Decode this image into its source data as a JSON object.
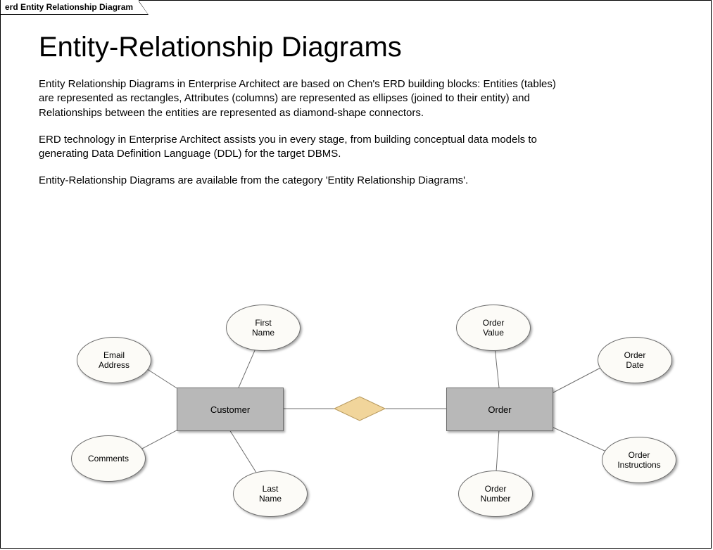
{
  "tab_label": "erd Entity Relationship Diagram",
  "title": "Entity-Relationship Diagrams",
  "para1": "Entity Relationship Diagrams in Enterprise Architect are based on Chen's ERD building blocks: Entities (tables) are represented as rectangles, Attributes (columns) are represented as ellipses (joined to their entity) and Relationships between the entities are represented as diamond-shape connectors.",
  "para2": "ERD technology in Enterprise Architect assists you in every stage, from building conceptual data models to generating Data Definition Language (DDL) for the target DBMS.",
  "para3": "Entity-Relationship Diagrams are available from the category 'Entity Relationship Diagrams'.",
  "entities": {
    "customer": "Customer",
    "order": "Order"
  },
  "attributes": {
    "first_name": "First\nName",
    "email_address": "Email\nAddress",
    "comments": "Comments",
    "last_name": "Last\nName",
    "order_value": "Order\nValue",
    "order_date": "Order\nDate",
    "order_number": "Order\nNumber",
    "order_instructions": "Order\nInstructions"
  }
}
